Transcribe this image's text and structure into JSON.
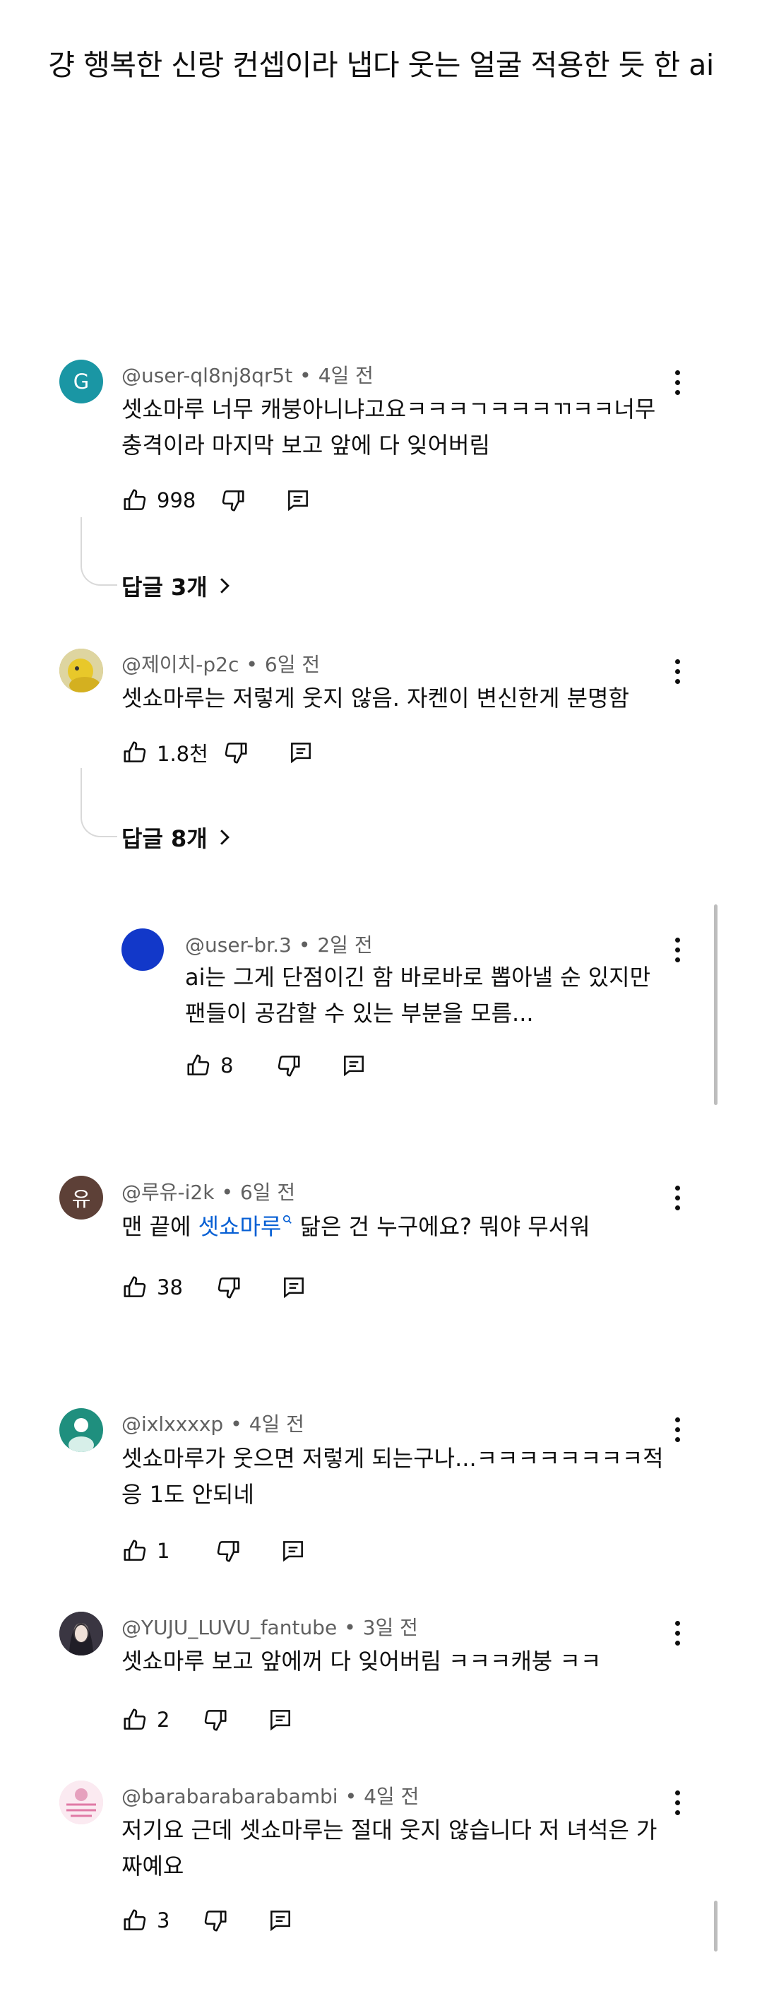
{
  "caption": "걍 행복한 신랑 컨셉이라 냅다 웃는 얼굴 적용한 듯 한 ai",
  "comments": [
    {
      "avatar_letter": "G",
      "avatar_color": "#1a96a4",
      "user": "@user-ql8nj8qr5t",
      "time": "4일 전",
      "text1": "셋쇼마루 너무 캐붕아니냐고요ㅋㅋㅋㄱㅋㅋㅋㄲㅋㅋ너무",
      "text2": "충격이라 마지막 보고 앞에 다 잊어버림",
      "likes": "998",
      "replies": "답글 3개"
    },
    {
      "avatar_color": "#c8b45a",
      "user": "@제이치-p2c",
      "time": "6일 전",
      "text1": "셋쇼마루는 저렇게 웃지 않음. 자켄이 변신한게 분명함",
      "likes": "1.8천",
      "replies": "답글 8개"
    },
    {
      "avatar_color": "#1238c9",
      "user": "@user-br.3",
      "time": "2일 전",
      "text1": "ai는 그게 단점이긴 함 바로바로 뽑아낼 순 있지만",
      "text2": "팬들이 공감할 수 있는 부분을 모름...",
      "likes": "8"
    },
    {
      "avatar_letter": "유",
      "avatar_color": "#5d4037",
      "user": "@루유-i2k",
      "time": "6일 전",
      "text_pre": "맨 끝에 ",
      "text_link": "셋쇼마루",
      "text_post": " 닮은 건 누구에요? 뭐야 무서워",
      "likes": "38"
    },
    {
      "avatar_color": "#1f8f7e",
      "user": "@ixlxxxxp",
      "time": "4일 전",
      "text1": "셋쇼마루가 웃으면 저렇게 되는구나...ㅋㅋㅋㅋㅋㅋㅋㅋ적",
      "text2": "응 1도 안되네",
      "likes": "1"
    },
    {
      "avatar_color": "#2a2a35",
      "user": "@YUJU_LUVU_fantube",
      "time": "3일 전",
      "text1": "셋쇼마루 보고 앞에꺼 다 잊어버림 ㅋㅋㅋ캐붕 ㅋㅋ",
      "likes": "2"
    },
    {
      "avatar_color": "#f6dbe8",
      "user": "@barabarabarabambi",
      "time": "4일 전",
      "text1": "저기요 근데 셋쇼마루는 절대 웃지 않습니다 저 녀석은 가",
      "text2": "짜예요",
      "likes": "3"
    }
  ]
}
